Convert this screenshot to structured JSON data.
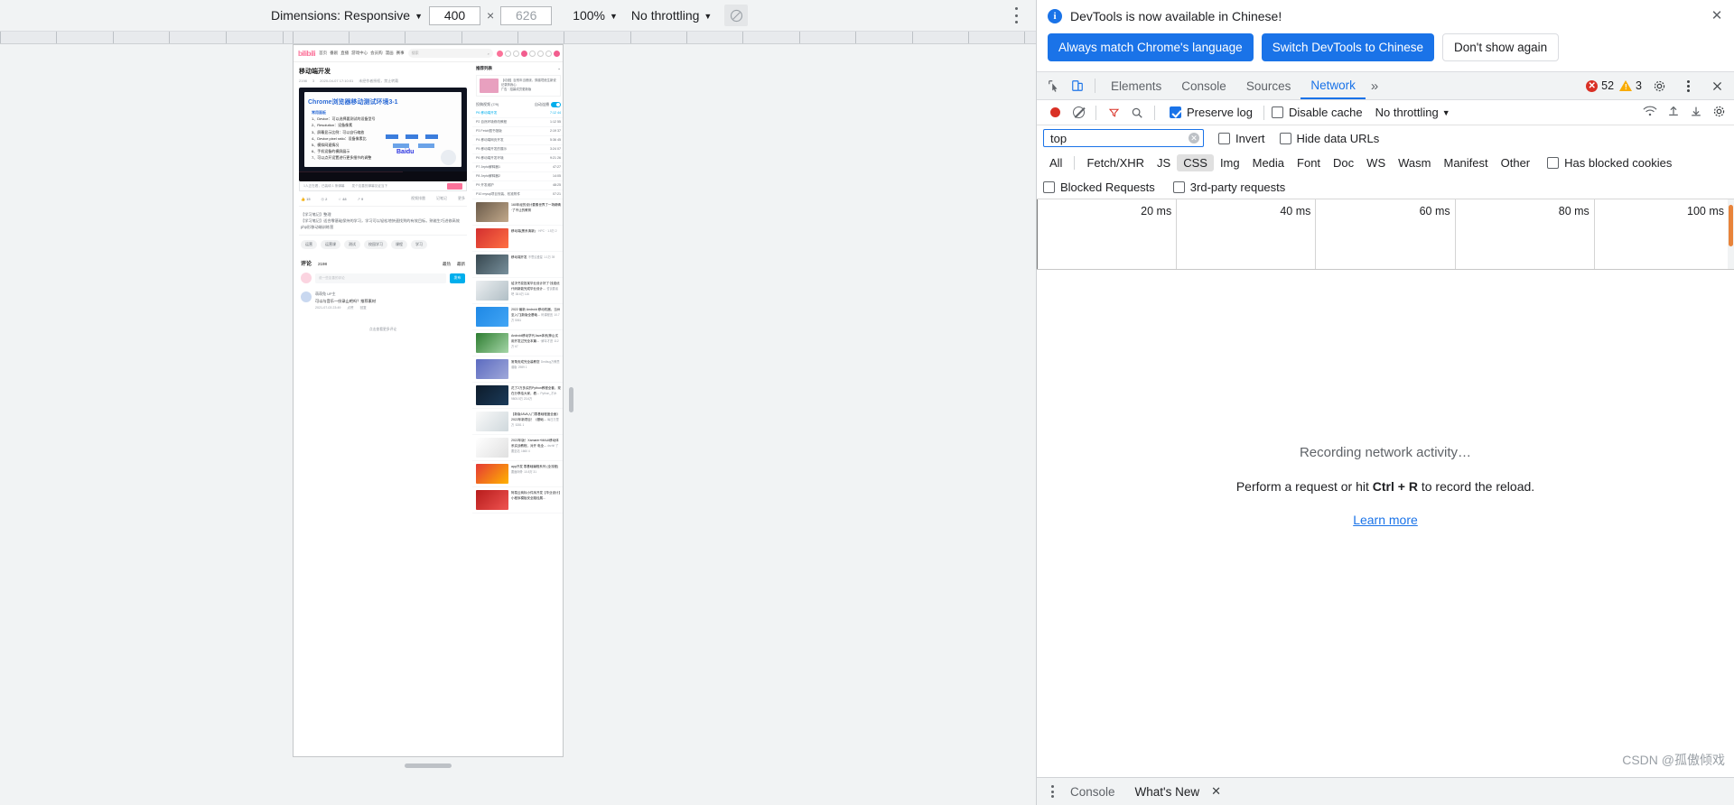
{
  "device_toolbar": {
    "dimensions_label": "Dimensions: Responsive",
    "width_value": "400",
    "height_placeholder": "626",
    "multiply": "×",
    "zoom_value": "100%",
    "throttling_value": "No throttling",
    "rotate_icon": "rotate-icon",
    "more_icon": "more-vertical-icon"
  },
  "bilibili": {
    "logo": "bilibili",
    "nav": [
      "首页",
      "番剧",
      "直播",
      "游戏中心",
      "会员购",
      "漫画",
      "赛事"
    ],
    "search_placeholder": "搜索",
    "video_title": "移动端开发",
    "video_meta": [
      "2198",
      "3",
      "2020-04-07 17:10:01",
      "未经作者授权，禁止转载"
    ],
    "slide_title": "Chrome浏览器移动测试环境3-1",
    "slide_heading": "常用面板",
    "slide_bullets": [
      "1、Device：可以选择要测试的设备型号",
      "2、Resolution：设备像素",
      "3、屏幕显示比例：可以自行缩放",
      "4、Device pixel ratio：设备像素比",
      "5、模拟网速情况",
      "6、手机设备的横屏展示",
      "7、可以点开设置进行更多细节的调整"
    ],
    "brand_logo": "Baidu",
    "danmaku_placeholder": "发个友善的弹幕见证当下",
    "send_label": "发送",
    "player_status": "1人正在看，已装填 1 条弹幕",
    "actions": [
      "15",
      "2",
      "48",
      "9"
    ],
    "action_right": [
      "视频排雷",
      "记笔记",
      "更多"
    ],
    "description_title": "【学习笔记】整理",
    "description": "【学习笔记】适合零基础保持的学习，学习可以轻松地快速找到的有效目标。熟能生巧进修高效php形移动端训练营",
    "tags": [
      "运营",
      "运营课",
      "测试",
      "校园学习",
      "课程",
      "学习"
    ],
    "comment_header": [
      "评论",
      "2198",
      "最热",
      "最新"
    ],
    "comment_placeholder": "说一些友善的评论",
    "comment_send": "发布",
    "comment_user": "萌萌兔 UP主",
    "comment_text": "可以与音乐一份录山吧吗？推荐素材",
    "comment_date": "2021-07-03 23:49",
    "comment_actions": [
      "点赞",
      "回复"
    ],
    "more_comments": "点击查看更多评论",
    "rail": {
      "tab_label": "推荐列表",
      "ad_text": [
        "【动漫】百别年当燃烧，穿越境绝生新说记录阵我心",
        "广告 · 招募成员更新版"
      ],
      "autoplay_label": "自动连播",
      "playlist_label": "投稿视频 (7/9)",
      "episodes": [
        {
          "name": "P6 移动端开发",
          "time": "7:12 44"
        },
        {
          "name": "P2 自然环境修改教程",
          "time": "1:12 55"
        },
        {
          "name": "P3 Fetch图书馆版",
          "time": "2:19 37"
        },
        {
          "name": "P4 移动端网页开发",
          "time": "5:36 45"
        },
        {
          "name": "P5 移动端开发的展示",
          "time": "3:24 07"
        },
        {
          "name": "P6 移动端开发环境",
          "time": "9:21 26"
        },
        {
          "name": "P7 Jepto解释器1",
          "time": "47:27"
        },
        {
          "name": "P8 Jepto解释器2",
          "time": "14:05"
        },
        {
          "name": "P9 开发维护",
          "time": "48:25"
        },
        {
          "name": "P10 mysql项目安装、校准附件",
          "time": "07:21"
        }
      ],
      "recommendations": [
        {
          "title": "160年经的设计要素世界了一场精确·了不让的教育",
          "up": "",
          "stats": ""
        },
        {
          "title": "移动端(黑系清新)",
          "up": "· HPC ·",
          "stats": "1.5万  2"
        },
        {
          "title": "移动端开发",
          "up": "不思议爱星",
          "stats": "1.1万  39"
        },
        {
          "title": "给决书变投某毕业设计好了·找准优代码新能完成毕业设计...",
          "up": "哲谈要者吧",
          "stats": "38.6万  116"
        },
        {
          "title": "2022 最新 Android 移动机器，当州至入门[新版全基础...",
          "up": "码课程宜",
          "stats": "10.7万  5061"
        },
        {
          "title": "Android移动学代Java体系[神山试用开发过完全本篇...",
          "up": "·解毒才进",
          "stats": "112万  67"
        },
        {
          "title": "常角安成完全装教您",
          "up": "Dedbug万教思谱版",
          "stats": "2989  1"
        },
        {
          "title": "花了2万多买的Python教程全套，现在分享给大家，看...",
          "up": "Python_才木",
          "stats": "9805.5万  23.6万"
        },
        {
          "title": "【新版JAVA入门零基础程度全面》2022年新项目！《基础...",
          "up": "每日万里万",
          "stats": "5281  1"
        },
        {
          "title": "2022年版！Xamarin+MAUI移动体系实战教程，对开 电全...",
          "up": "dsrhif 了要至站",
          "stats": "1660  4"
        },
        {
          "title": "app开发 零基础编程系列 (全流程)",
          "up": "要面网骨",
          "stats": "10.8万  31"
        },
        {
          "title": "阿易云商标小件序开发【毕业设计】小程序模板安全路径展...",
          "up": "",
          "stats": ""
        }
      ]
    }
  },
  "devtools": {
    "banner": {
      "message": "DevTools is now available in Chinese!",
      "info_icon": "info-icon",
      "buttons": [
        {
          "label": "Always match Chrome's language",
          "style": "primary"
        },
        {
          "label": "Switch DevTools to Chinese",
          "style": "primary"
        },
        {
          "label": "Don't show again",
          "style": "plain"
        }
      ],
      "close_icon": "close-icon"
    },
    "tabs": {
      "inspect_icon": "inspect-cursor-icon",
      "device_icon": "device-toolbar-icon",
      "items": [
        "Elements",
        "Console",
        "Sources",
        "Network"
      ],
      "active": "Network",
      "more_icon": "chevron-double-right-icon",
      "errors": "52",
      "warnings": "3",
      "settings_icon": "gear-icon",
      "kebab_icon": "more-vertical-icon",
      "close_icon": "close-icon"
    },
    "network_toolbar": {
      "record_icon": "record-icon",
      "clear_icon": "clear-icon",
      "filter_icon": "filter-icon",
      "search_icon": "search-icon",
      "preserve_log": {
        "label": "Preserve log",
        "checked": true
      },
      "disable_cache": {
        "label": "Disable cache",
        "checked": false
      },
      "throttling": "No throttling",
      "wifi_icon": "network-conditions-icon",
      "import_icon": "import-har-icon",
      "export_icon": "export-har-icon",
      "settings_icon": "gear-icon"
    },
    "filter": {
      "value": "top",
      "clear_icon": "clear-input-icon",
      "invert": {
        "label": "Invert",
        "checked": false
      },
      "hide_data_urls": {
        "label": "Hide data URLs",
        "checked": false
      },
      "types": [
        "All",
        "Fetch/XHR",
        "JS",
        "CSS",
        "Img",
        "Media",
        "Font",
        "Doc",
        "WS",
        "Wasm",
        "Manifest",
        "Other"
      ],
      "selected_type": "CSS",
      "has_blocked_cookies": {
        "label": "Has blocked cookies",
        "checked": false
      },
      "blocked_requests": {
        "label": "Blocked Requests",
        "checked": false
      },
      "third_party": {
        "label": "3rd-party requests",
        "checked": false
      }
    },
    "timeline": {
      "ticks": [
        "20 ms",
        "40 ms",
        "60 ms",
        "80 ms",
        "100 ms"
      ]
    },
    "empty_state": {
      "line1": "Recording network activity…",
      "line2_pre": "Perform a request or hit ",
      "line2_key": "Ctrl + R",
      "line2_post": " to record the reload.",
      "link": "Learn more"
    },
    "drawer": {
      "kebab_icon": "more-vertical-icon",
      "tabs": [
        "Console",
        "What's New"
      ],
      "active": "What's New",
      "close_icon": "close-icon"
    }
  },
  "watermark": "CSDN @孤傲倾戏"
}
